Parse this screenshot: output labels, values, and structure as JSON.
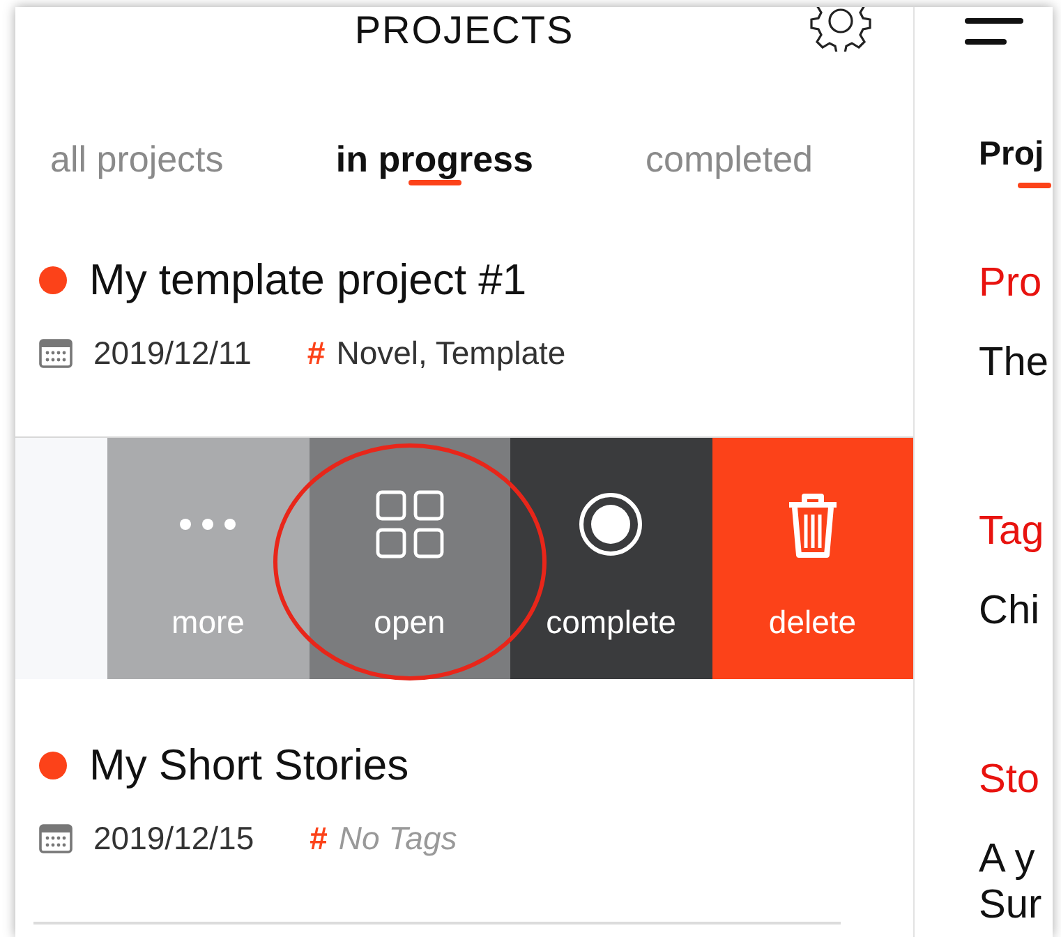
{
  "header": {
    "title": "PROJECTS"
  },
  "tabs": [
    {
      "label": "all projects",
      "selected": false
    },
    {
      "label": "in progress",
      "selected": true
    },
    {
      "label": "completed",
      "selected": false
    }
  ],
  "projects": [
    {
      "title": "My template project #1",
      "date": "2019/12/11",
      "tag_mark": "#",
      "tags": "Novel, Template",
      "has_tags": true,
      "actions": [
        {
          "kind": "more",
          "label": "more",
          "highlighted": false
        },
        {
          "kind": "open",
          "label": "open",
          "highlighted": true
        },
        {
          "kind": "complete",
          "label": "complete",
          "highlighted": false
        },
        {
          "kind": "delete",
          "label": "delete",
          "highlighted": false
        }
      ]
    },
    {
      "title": "My Short Stories",
      "date": "2019/12/15",
      "tag_mark": "#",
      "tags": "No Tags",
      "has_tags": false
    }
  ],
  "detail": {
    "tab": "Proj",
    "sections": [
      {
        "heading": "Pro",
        "body": [
          "The"
        ]
      },
      {
        "heading": "Tag",
        "body": [
          "Chi"
        ]
      },
      {
        "heading": "Sto",
        "body": [
          "A y",
          "Sur"
        ]
      }
    ]
  }
}
